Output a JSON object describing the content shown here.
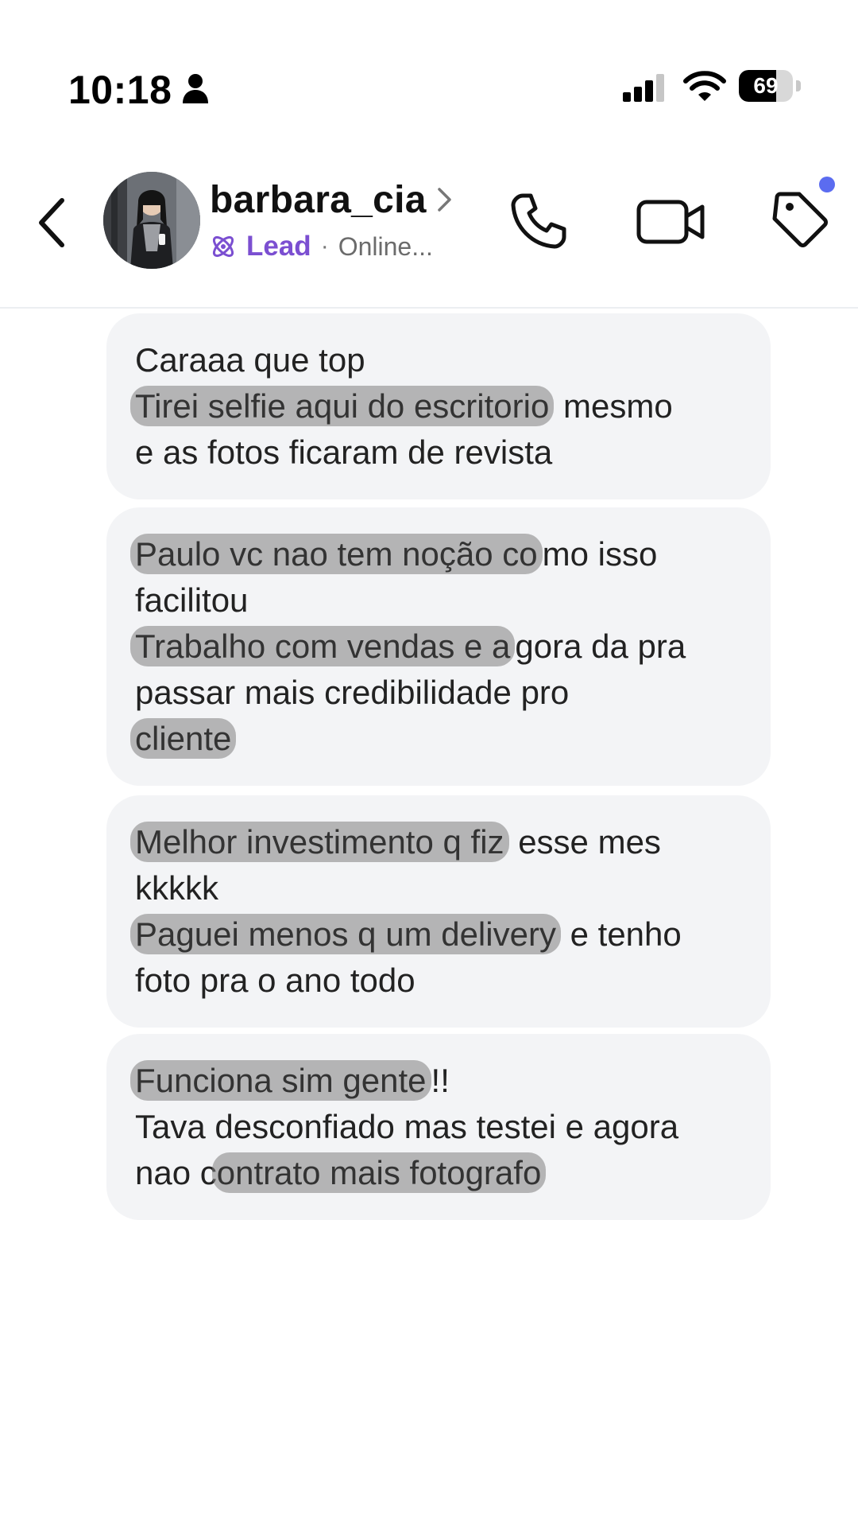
{
  "status_bar": {
    "time": "10:18",
    "battery_level": "69",
    "battery_fraction": 0.69,
    "icons": [
      "person-icon",
      "cellular-signal-icon",
      "wifi-icon",
      "battery-icon"
    ]
  },
  "header": {
    "username": "barbara_cia",
    "label": "Lead",
    "separator": "·",
    "status": "Online...",
    "label_color": "#7b4fd1",
    "notification_color": "#5b6cf0",
    "icons": [
      "back-chevron-icon",
      "chevron-right-icon",
      "lead-atom-icon",
      "phone-icon",
      "video-camera-icon",
      "tag-icon"
    ]
  },
  "messages": [
    {
      "lines": [
        [
          {
            "text": "Caraaa que top",
            "highlight": false
          }
        ],
        [
          {
            "text": "Tirei selfie aqui do escritorio",
            "highlight": true
          },
          {
            "text": " mesmo",
            "highlight": false
          }
        ],
        [
          {
            "text": "e as fotos ficaram de revista",
            "highlight": false
          }
        ]
      ]
    },
    {
      "lines": [
        [
          {
            "text": "Paulo vc nao tem noção co",
            "highlight": true
          },
          {
            "text": "mo isso",
            "highlight": false
          }
        ],
        [
          {
            "text": "facilitou",
            "highlight": false
          }
        ],
        [
          {
            "text": "Trabalho com vendas e a",
            "highlight": true
          },
          {
            "text": "gora da pra",
            "highlight": false
          }
        ],
        [
          {
            "text": "passar mais credibilidade pro",
            "highlight": false
          }
        ],
        [
          {
            "text": "cliente",
            "highlight": true
          }
        ]
      ]
    },
    {
      "lines": [
        [
          {
            "text": "Melhor investimento q fiz",
            "highlight": true
          },
          {
            "text": " esse mes",
            "highlight": false
          }
        ],
        [
          {
            "text": "kkkkk",
            "highlight": false
          }
        ],
        [
          {
            "text": "Paguei menos q um delivery",
            "highlight": true
          },
          {
            "text": " e tenho",
            "highlight": false
          }
        ],
        [
          {
            "text": "foto pra o ano todo",
            "highlight": false
          }
        ]
      ]
    },
    {
      "lines": [
        [
          {
            "text": "Funciona sim gente",
            "highlight": true
          },
          {
            "text": "!!",
            "highlight": false
          }
        ],
        [
          {
            "text": "Tava desconfiado mas testei e agora",
            "highlight": false
          }
        ],
        [
          {
            "text": "nao c",
            "highlight": false
          },
          {
            "text": "ontrato mais fotografo",
            "highlight": true
          }
        ]
      ]
    }
  ]
}
